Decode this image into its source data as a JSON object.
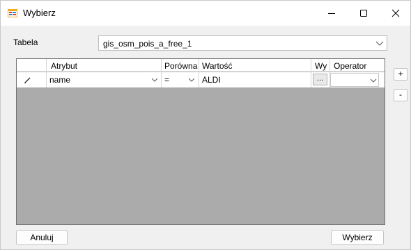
{
  "window": {
    "title": "Wybierz",
    "icon": "form-icon"
  },
  "table_selector": {
    "label": "Tabela",
    "value": "gis_osm_pois_a_free_1"
  },
  "grid": {
    "columns": [
      "",
      "Atrybut",
      "Porówna",
      "Wartość",
      "Wy",
      "Operator"
    ],
    "rows": [
      {
        "indicator": "edit-pencil-icon",
        "attribute": "name",
        "comparison": "=",
        "value": "ALDI",
        "picker_label": "...",
        "operator": ""
      }
    ]
  },
  "side_buttons": {
    "add_label": "+",
    "remove_label": "-"
  },
  "buttons": {
    "cancel_label": "Anuluj",
    "select_label": "Wybierz"
  },
  "colors": {
    "grid_background": "#ababab",
    "window_background": "#f0f0f0"
  }
}
